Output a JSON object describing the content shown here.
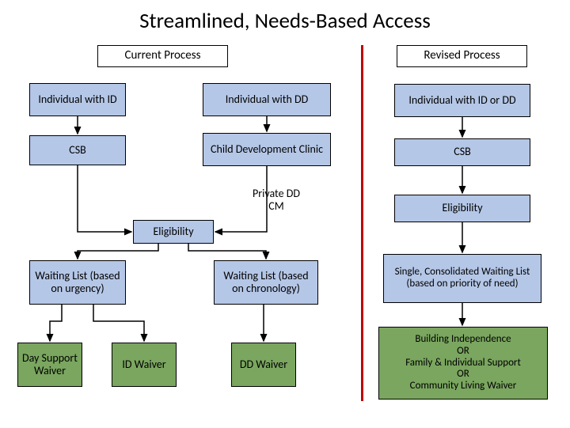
{
  "title": "Streamlined, Needs-Based Access",
  "headers": {
    "current": "Current Process",
    "revised": "Revised Process"
  },
  "current": {
    "indiv_id": "Individual with ID",
    "indiv_dd": "Individual with DD",
    "csb": "CSB",
    "cdc": "Child Development Clinic",
    "private_ddcm": "Private DD CM",
    "eligibility": "Eligibility",
    "wl_urgency": "Waiting List (based on urgency)",
    "wl_chronology": "Waiting List (based on chronology)",
    "day_support": "Day Support Waiver",
    "id_waiver": "ID Waiver",
    "dd_waiver": "DD Waiver"
  },
  "revised": {
    "indiv": "Individual with ID or DD",
    "csb": "CSB",
    "eligibility": "Eligibility",
    "waiting_list": "Single, Consolidated Waiting List\n(based on priority of need)",
    "waivers": "Building Independence\nOR\nFamily & Individual Support\nOR\nCommunity Living Waiver"
  }
}
